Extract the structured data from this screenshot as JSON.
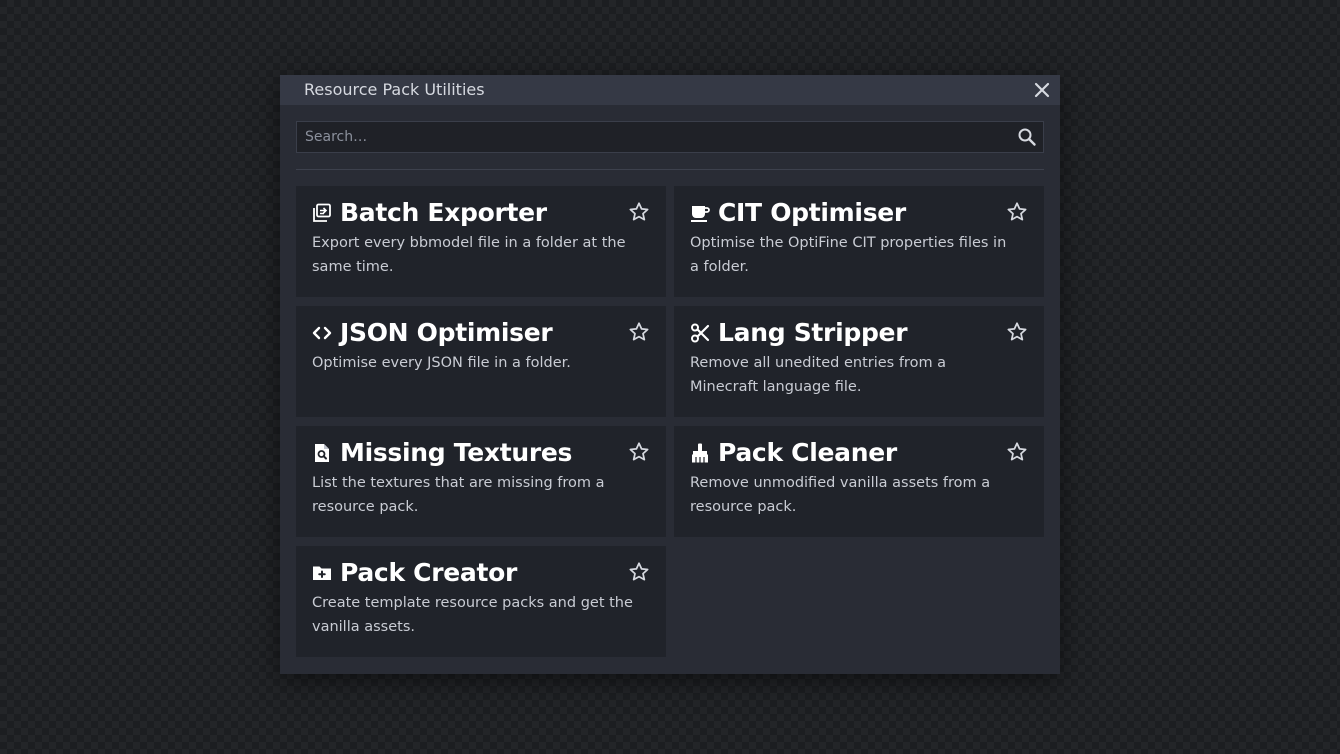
{
  "dialog": {
    "title": "Resource Pack Utilities",
    "close_icon": "close-icon"
  },
  "search": {
    "placeholder": "Search…",
    "value": "",
    "icon": "search-icon"
  },
  "tools": [
    {
      "title": "Batch Exporter",
      "description": "Export every bbmodel file in a folder at the same time.",
      "icon": "batch-export-icon"
    },
    {
      "title": "CIT Optimiser",
      "description": "Optimise the OptiFine CIT properties files in a folder.",
      "icon": "coffee-cup-icon"
    },
    {
      "title": "JSON Optimiser",
      "description": "Optimise every JSON file in a folder.",
      "icon": "code-brackets-icon"
    },
    {
      "title": "Lang Stripper",
      "description": "Remove all unedited entries from a Minecraft language file.",
      "icon": "scissors-icon"
    },
    {
      "title": "Missing Textures",
      "description": "List the textures that are missing from a resource pack.",
      "icon": "file-search-icon"
    },
    {
      "title": "Pack Cleaner",
      "description": "Remove unmodified vanilla assets from a resource pack.",
      "icon": "broom-icon"
    },
    {
      "title": "Pack Creator",
      "description": "Create template resource packs and get the vanilla assets.",
      "icon": "folder-plus-icon"
    }
  ],
  "colors": {
    "background": "#1f2124",
    "dialog": "#292c35",
    "titlebar": "#353945",
    "card": "#20232a",
    "text": "#ffffff",
    "muted": "#c9ccd4"
  }
}
